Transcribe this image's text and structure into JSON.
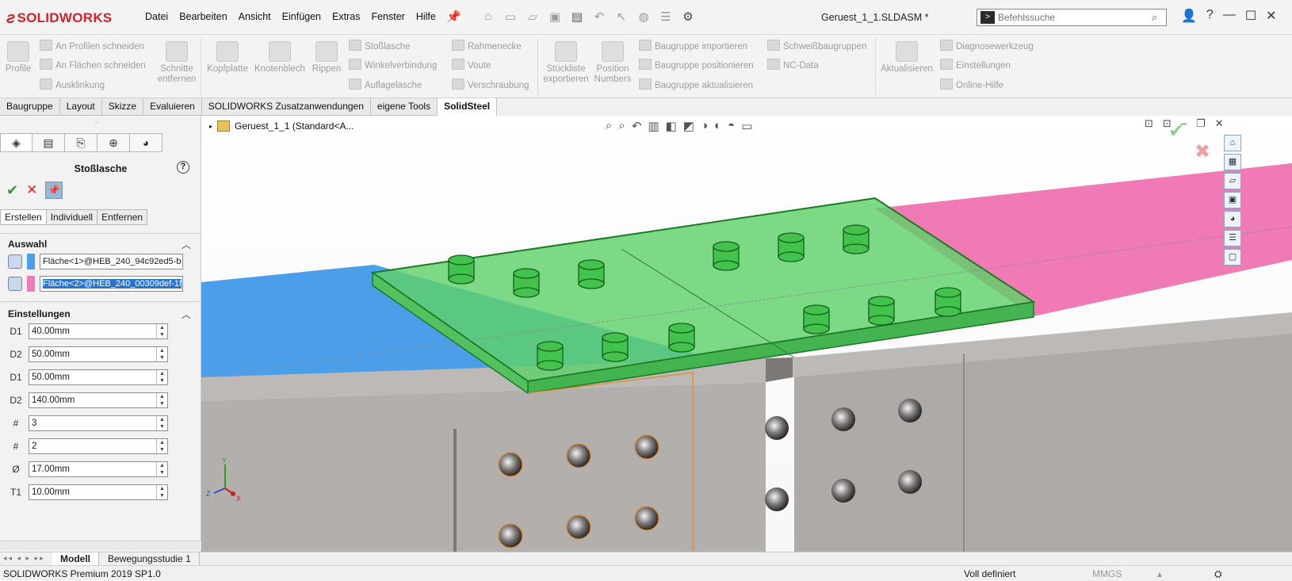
{
  "app": {
    "logo_text": "SOLIDWORKS",
    "doc_title": "Geruest_1_1.SLDASM *",
    "search_placeholder": "Befehlssuche"
  },
  "menu": [
    "Datei",
    "Bearbeiten",
    "Ansicht",
    "Einfügen",
    "Extras",
    "Fenster",
    "Hilfe"
  ],
  "ribbon": {
    "profile": "Profile",
    "col1": [
      "An Profilen schneiden",
      "An Flächen schneiden",
      "Ausklinkung"
    ],
    "schnitte": [
      "Schnitte",
      "entfernen"
    ],
    "kopfplatte": "Kopfplatte",
    "knotenblech": "Knotenblech",
    "rippen": "Rippen",
    "col2": [
      "Stoßlasche",
      "Winkelverbindung",
      "Auflagelasche"
    ],
    "col3": [
      "Rahmenecke",
      "Voute",
      "Verschraubung"
    ],
    "stueckliste": [
      "Stückliste",
      "exportieren"
    ],
    "position": [
      "Position",
      "Numbers"
    ],
    "col4": [
      "Baugruppe importieren",
      "Baugruppe positionieren",
      "Baugruppe aktualisieren"
    ],
    "col5": [
      "Schweißbaugruppen",
      "NC-Data"
    ],
    "aktualisieren": "Aktualisieren",
    "col6": [
      "Diagnosewerkzeug",
      "Einstellungen",
      "Online-Hilfe"
    ]
  },
  "tabs": [
    "Baugruppe",
    "Layout",
    "Skizze",
    "Evaluieren",
    "SOLIDWORKS Zusatzanwendungen",
    "eigene Tools",
    "SolidSteel"
  ],
  "active_tab": "SolidSteel",
  "panel": {
    "title": "Stoßlasche",
    "subtabs": [
      "Erstellen",
      "Individuell",
      "Entfernen"
    ],
    "auswahl_label": "Auswahl",
    "selection": [
      {
        "text": "Fläche<1>@HEB_240_94c92ed5-b",
        "color": "#4a9fe8"
      },
      {
        "text": "Fläche<2>@HEB_240_00309def-1f",
        "color": "#f07ab5"
      }
    ],
    "einstellungen_label": "Einstellungen",
    "params": [
      {
        "icon": "D1",
        "value": "40.00mm"
      },
      {
        "icon": "D2",
        "value": "50.00mm"
      },
      {
        "icon": "D1",
        "value": "50.00mm"
      },
      {
        "icon": "D2",
        "value": "140.00mm"
      },
      {
        "icon": "#",
        "value": "3"
      },
      {
        "icon": "#",
        "value": "2"
      },
      {
        "icon": "Ø",
        "value": "17.00mm"
      },
      {
        "icon": "T1",
        "value": "10.00mm"
      }
    ]
  },
  "viewport": {
    "tree_item": "Geruest_1_1  (Standard<A...",
    "axes": {
      "x": "X",
      "y": "Y",
      "z": "Z"
    }
  },
  "bottom_tabs": [
    "Modell",
    "Bewegungsstudie 1"
  ],
  "status": {
    "product": "SOLIDWORKS Premium 2019 SP1.0",
    "state": "Voll definiert",
    "units": "MMGS"
  },
  "colors": {
    "accent": "#d2232a",
    "beam_face_left": "#4a9fe8",
    "beam_face_right": "#f07ab5",
    "plate": "#39c04a",
    "steel": "#b3afac"
  }
}
